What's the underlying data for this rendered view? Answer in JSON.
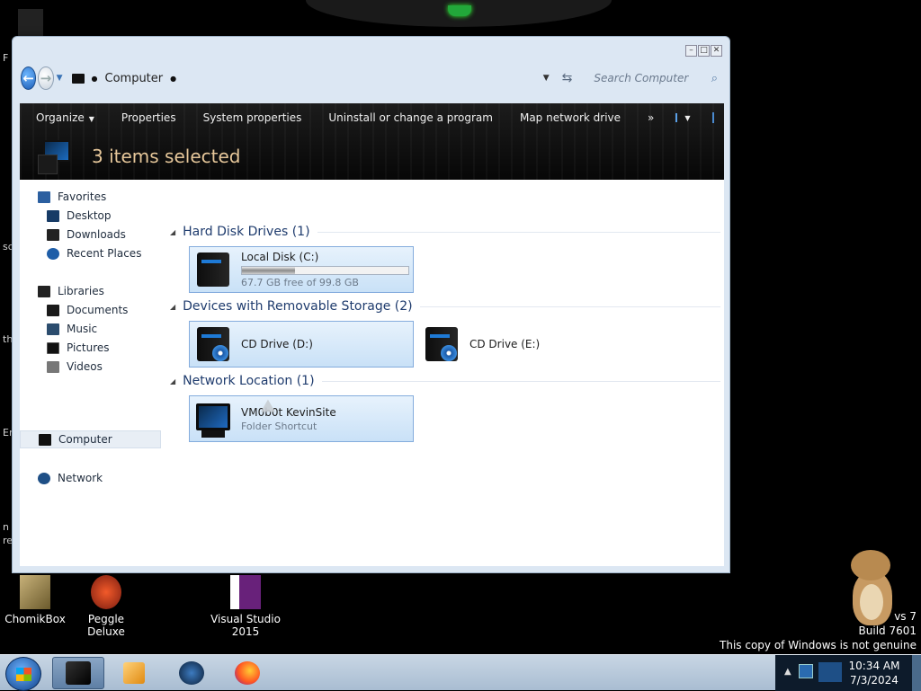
{
  "window": {
    "address": {
      "location": "Computer"
    },
    "search": {
      "placeholder": "Search Computer"
    },
    "toolbar": {
      "organize": "Organize",
      "properties": "Properties",
      "system_properties": "System properties",
      "uninstall": "Uninstall or change a program",
      "map_drive": "Map network drive",
      "more": "»"
    },
    "header": {
      "status": "3 items selected"
    },
    "nav": {
      "favorites": "Favorites",
      "desktop": "Desktop",
      "downloads": "Downloads",
      "recent": "Recent Places",
      "libraries": "Libraries",
      "documents": "Documents",
      "music": "Music",
      "pictures": "Pictures",
      "videos": "Videos",
      "computer": "Computer",
      "network": "Network"
    },
    "groups": {
      "hdd": {
        "title": "Hard Disk Drives (1)"
      },
      "removable": {
        "title": "Devices with Removable Storage (2)"
      },
      "network": {
        "title": "Network Location (1)"
      }
    },
    "drives": {
      "c": {
        "name": "Local Disk (C:)",
        "free": "67.7 GB free of 99.8 GB",
        "used_fraction": 0.32
      },
      "d": {
        "name": "CD Drive (D:)"
      },
      "e": {
        "name": "CD Drive (E:)"
      }
    },
    "netloc": {
      "name": "VM0b0t KevinSite",
      "type": "Folder Shortcut"
    }
  },
  "desktop": {
    "icons": {
      "chomik": "ChomikBox",
      "peggle": "Peggle Deluxe",
      "vs": "Visual Studio 2015"
    },
    "watermark": {
      "line1": "vs 7",
      "line2": "Build 7601",
      "line3": "This copy of Windows is not genuine"
    },
    "edge_fragments": [
      "F",
      "sc",
      "th",
      "Er",
      "n",
      "re"
    ]
  },
  "taskbar": {
    "time": "10:34 AM",
    "date": "7/3/2024"
  },
  "colors": {
    "header_text": "#e6c79a",
    "group_title": "#1e3b6d",
    "selection": "#c9e1f7"
  }
}
